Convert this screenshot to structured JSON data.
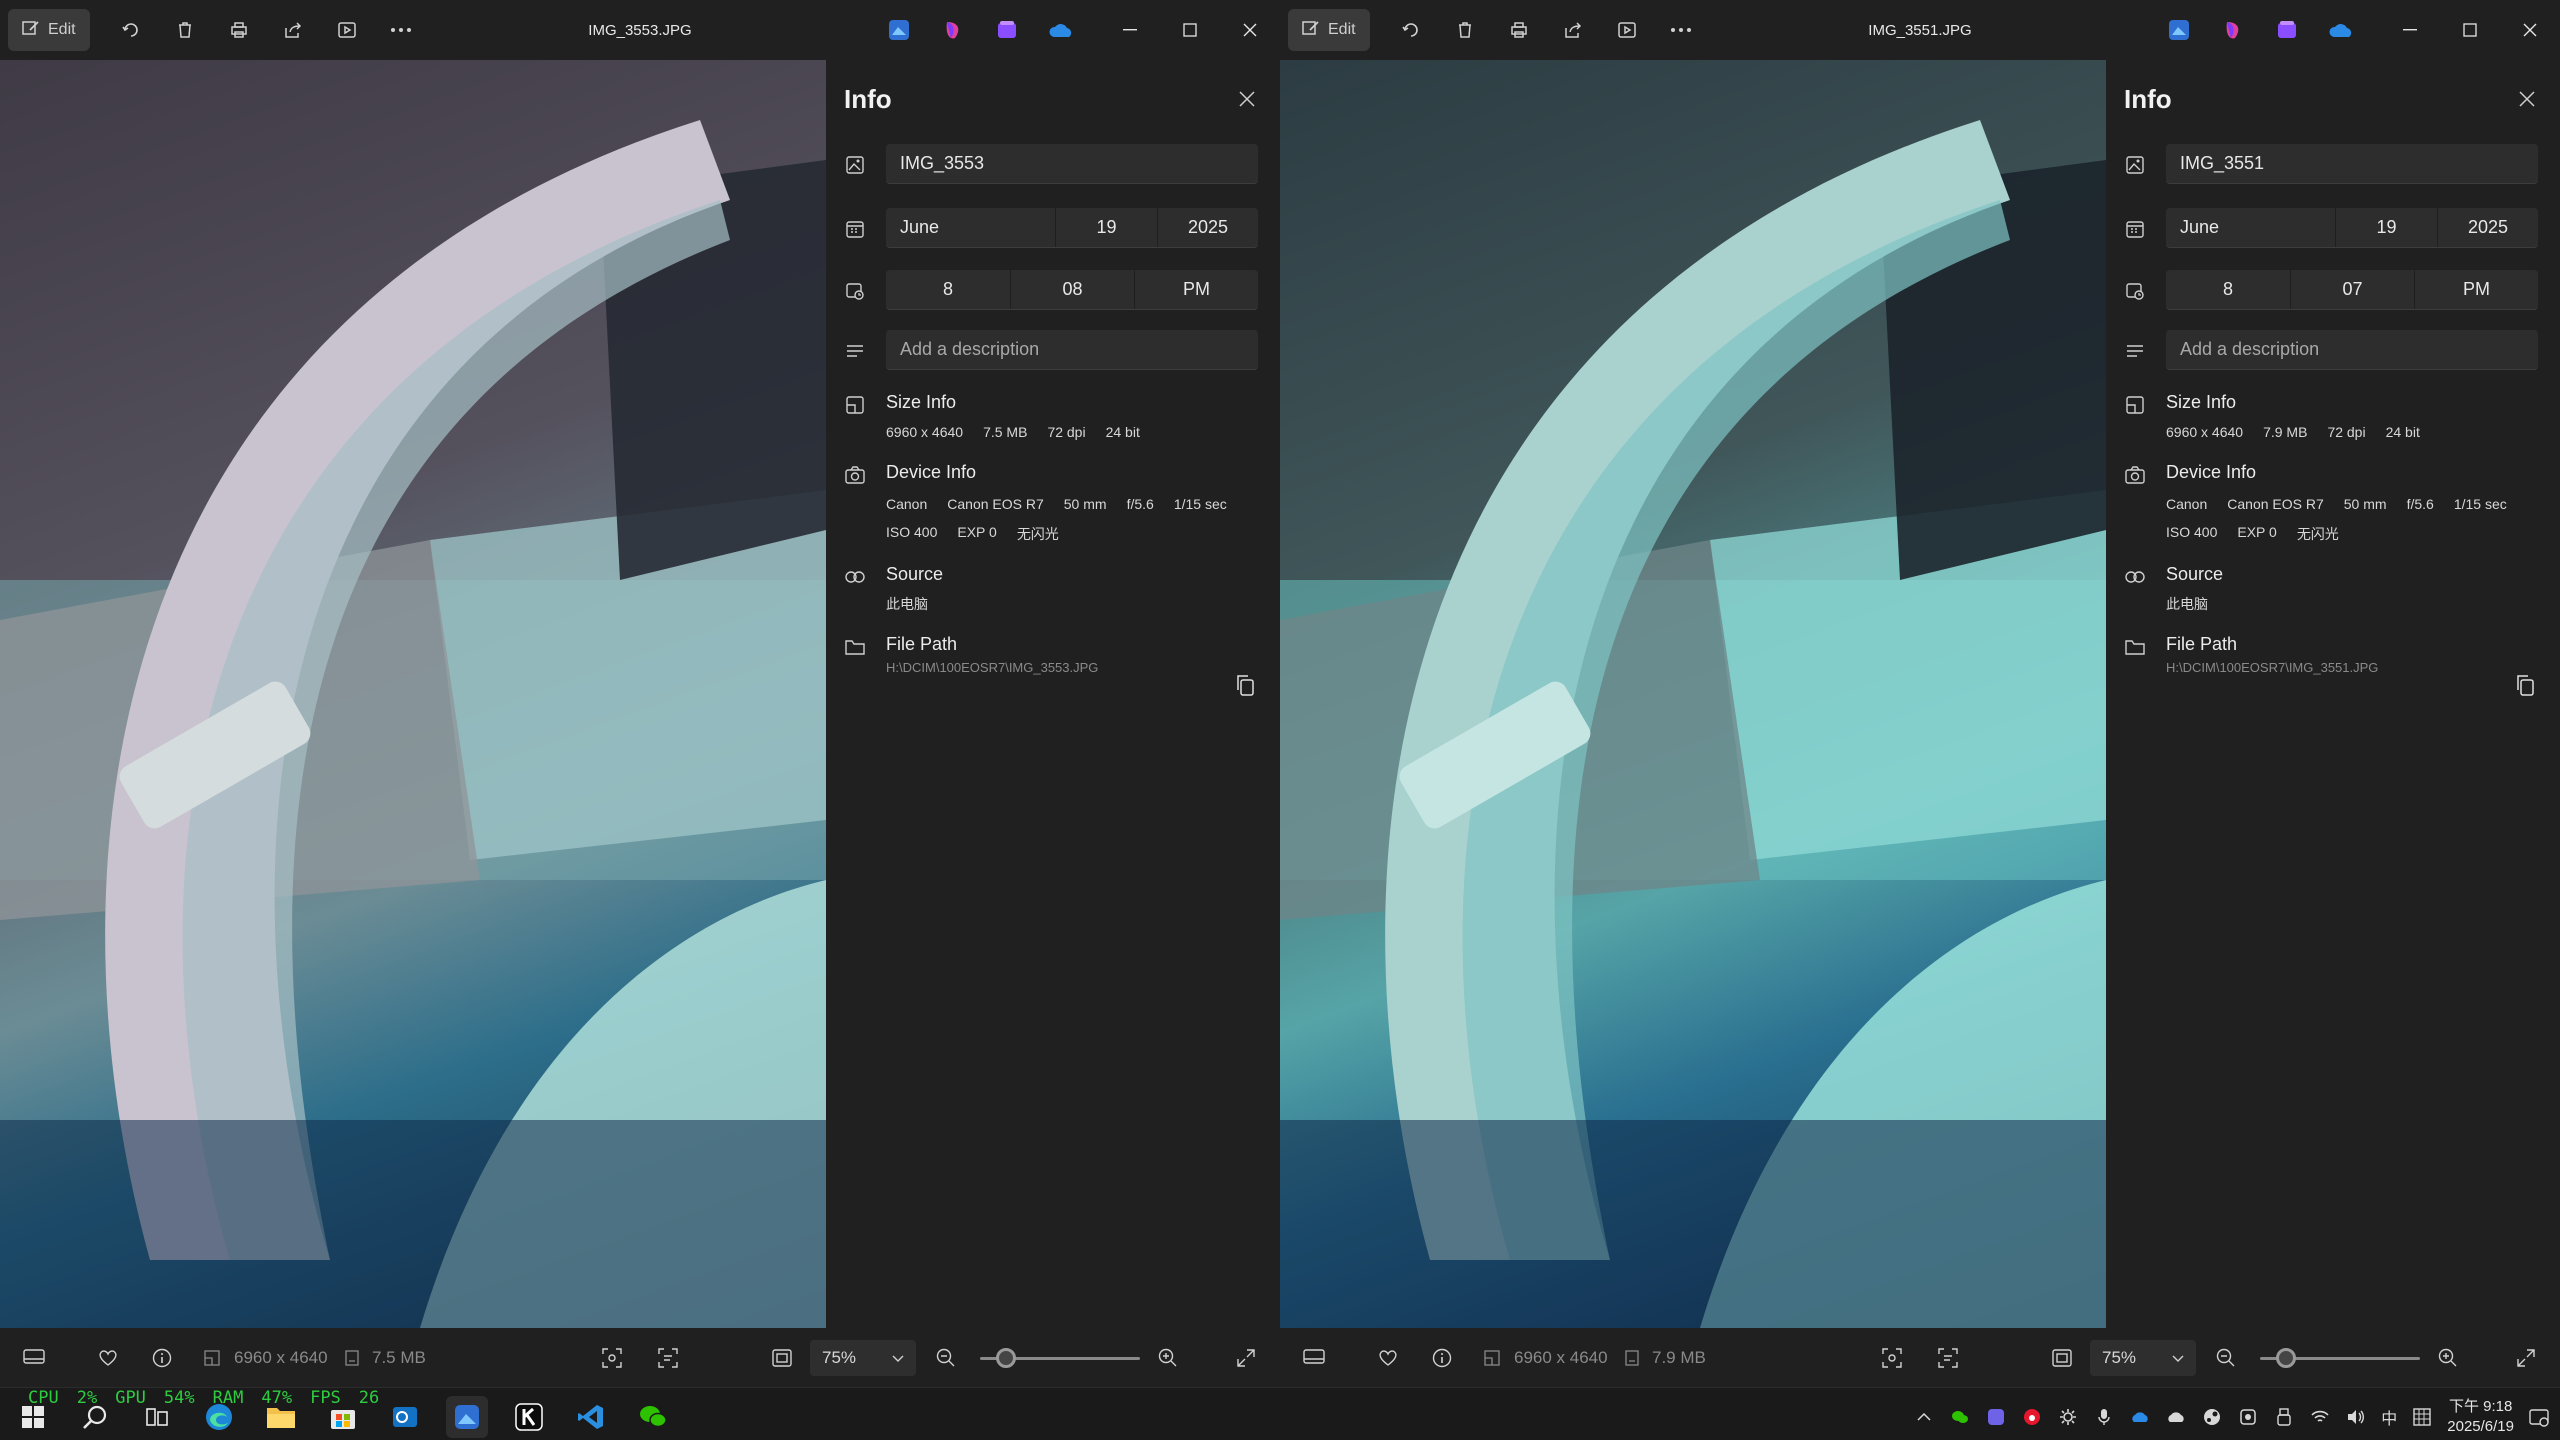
{
  "windows": [
    {
      "title": "IMG_3553.JPG",
      "toolbar": {
        "edit_label": "Edit"
      },
      "info": {
        "heading": "Info",
        "name": "IMG_3553",
        "date": {
          "month": "June",
          "day": "19",
          "year": "2025"
        },
        "time": {
          "hour": "8",
          "minute": "08",
          "ampm": "PM"
        },
        "description_placeholder": "Add a description",
        "size_info": {
          "title": "Size Info",
          "dims": "6960 x 4640",
          "size": "7.5 MB",
          "dpi": "72 dpi",
          "bits": "24 bit"
        },
        "device_info": {
          "title": "Device Info",
          "make": "Canon",
          "model": "Canon EOS R7",
          "focal": "50 mm",
          "aperture": "f/5.6",
          "shutter": "1/15 sec",
          "iso": "ISO 400",
          "exp": "EXP 0",
          "flash": "无闪光"
        },
        "source": {
          "title": "Source",
          "value": "此电脑"
        },
        "file_path": {
          "title": "File Path",
          "value": "H:\\DCIM\\100EOSR7\\IMG_3553.JPG"
        }
      },
      "bottom": {
        "dims": "6960 x 4640",
        "size": "7.5 MB",
        "zoom": "75%",
        "zoom_level": 0.16
      }
    },
    {
      "title": "IMG_3551.JPG",
      "toolbar": {
        "edit_label": "Edit"
      },
      "info": {
        "heading": "Info",
        "name": "IMG_3551",
        "date": {
          "month": "June",
          "day": "19",
          "year": "2025"
        },
        "time": {
          "hour": "8",
          "minute": "07",
          "ampm": "PM"
        },
        "description_placeholder": "Add a description",
        "size_info": {
          "title": "Size Info",
          "dims": "6960 x 4640",
          "size": "7.9 MB",
          "dpi": "72 dpi",
          "bits": "24 bit"
        },
        "device_info": {
          "title": "Device Info",
          "make": "Canon",
          "model": "Canon EOS R7",
          "focal": "50 mm",
          "aperture": "f/5.6",
          "shutter": "1/15 sec",
          "iso": "ISO 400",
          "exp": "EXP 0",
          "flash": "无闪光"
        },
        "source": {
          "title": "Source",
          "value": "此电脑"
        },
        "file_path": {
          "title": "File Path",
          "value": "H:\\DCIM\\100EOSR7\\IMG_3551.JPG"
        }
      },
      "bottom": {
        "dims": "6960 x 4640",
        "size": "7.9 MB",
        "zoom": "75%",
        "zoom_level": 0.16
      }
    }
  ],
  "taskbar": {
    "perf": {
      "cpu": "CPU",
      "cpu_val": "2%",
      "gpu": "GPU",
      "gpu_val": "54%",
      "ram": "RAM",
      "ram_val": "47%",
      "fps": "FPS",
      "fps_val": "26"
    },
    "ime": "中",
    "clock_time": "下午 9:18",
    "clock_date": "2025/6/19"
  },
  "colors": {
    "accent": "#4cc2ff",
    "perf_text": "#2ecc40",
    "pane_bg": "#202020",
    "field_bg": "#2d2d2d"
  }
}
